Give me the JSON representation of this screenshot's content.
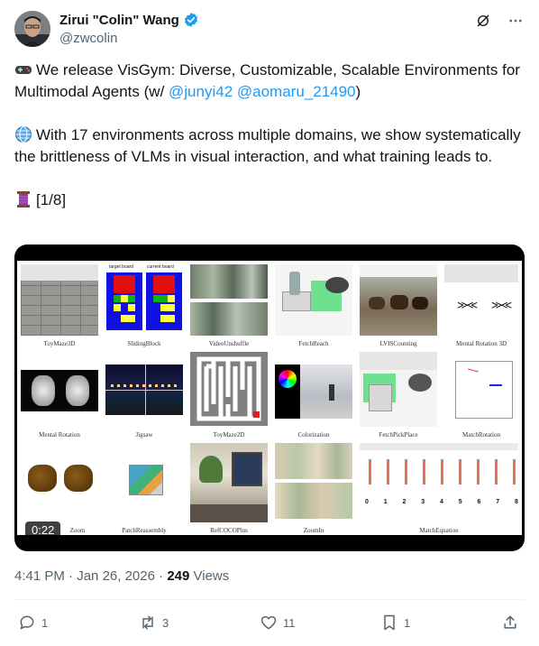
{
  "author": {
    "display_name": "Zirui \"Colin\" Wang",
    "handle": "@zwcolin",
    "verified_color": "#1d9bf0"
  },
  "tweet": {
    "line1_emoji": "gamepad-icon",
    "line1_text": "We release VisGym: Diverse, Customizable, Scalable Environments for Multimodal Agents (w/ ",
    "mention1": "@junyi42",
    "mention2": "@aomaru_21490",
    "line1_end": ")",
    "line2_emoji": "globe-icon",
    "line2_text": "With 17 environments across multiple domains, we show systematically the brittleness of VLMs in visual interaction, and what training leads to.",
    "thread_emoji": "thread-spool-icon",
    "thread_marker": "[1/8]"
  },
  "media": {
    "duration": "0:22",
    "captions": {
      "toymaze3d": "ToyMaze3D",
      "slidingblock": "SlidingBlock",
      "videounshuffle": "VideoUnshuffle",
      "fetchreach": "FetchReach",
      "lvis": "LVISCounting",
      "mentalrot3d": "Mental Rotation 3D",
      "mentalrot": "Mental Rotation",
      "jigsaw": "Jigsaw",
      "toymaze2d": "ToyMaze2D",
      "colorization": "Colorization",
      "fetchpick": "FetchPickPlace",
      "matchrot": "MatchRotation",
      "zoom": "Zoom",
      "patch": "PatchReassembly",
      "refcoco": "RefCOCOPlus",
      "zoomin": "ZoomIn",
      "matcheq": "MatchEquation"
    },
    "sliding_labels": {
      "target": "target board",
      "current": "current board"
    },
    "equation_digits": [
      "0",
      "1",
      "2",
      "3",
      "4",
      "5",
      "6",
      "7",
      "8"
    ]
  },
  "meta": {
    "time": "4:41 PM",
    "separator": "·",
    "date": "Jan 26, 2026",
    "views_count": "249",
    "views_label": "Views"
  },
  "actions": {
    "replies": "1",
    "reposts": "3",
    "likes": "11",
    "bookmarks": "1"
  },
  "colors": {
    "text": "#0f1419",
    "secondary": "#536471",
    "link": "#1d9bf0"
  }
}
